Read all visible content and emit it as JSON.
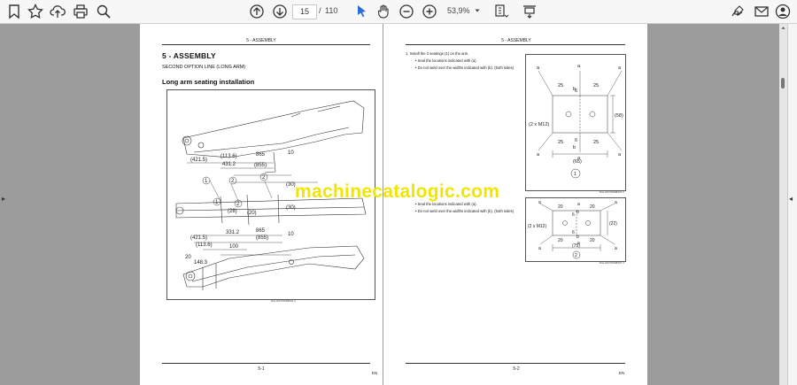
{
  "toolbar": {
    "current_page": "15",
    "page_separator": "/",
    "total_pages": "110",
    "zoom": "53,9%"
  },
  "left_page": {
    "header": "5 - ASSEMBLY",
    "title": "5 - ASSEMBLY",
    "subtitle": "SECOND OPTION LINE (LONG ARM)",
    "section": "Long arm seating installation",
    "figure_ref": "DALGSTOSSB001  1",
    "footer_page": "5-1",
    "dims": [
      "(421.5)",
      "(113.6)",
      "431.2",
      "865",
      "(855)",
      "10",
      "(421.5)",
      "(113.6)",
      "331.2",
      "865",
      "(855)",
      "10",
      "100",
      "20",
      "148.3",
      "(28)",
      "(20)",
      "(30)",
      "(30)",
      "1",
      "2",
      "2",
      "1",
      "2"
    ]
  },
  "right_page": {
    "header": "5 - ASSEMBLY",
    "instruction": "Install the 2 seatings (1) on the arm.",
    "bullet1": "Seal the locations indicated with (a).",
    "bullet2": "Do not weld over the widths indicated with (b). (both sides)",
    "bullet3": "Seal the locations indicated with (a).",
    "bullet4": "Do not weld over the widths indicated with (b). (both sides)",
    "figure_ref_1": "DALGSTOSSB007  2",
    "figure_ref_2": "DALGSTOSSB007  3",
    "footer_page": "5-2",
    "en": "EN",
    "fig1_labels": [
      "a",
      "a",
      "a",
      "a",
      "a",
      "a",
      "25",
      "25",
      "25",
      "25",
      "6",
      "6",
      "(2 x M12)",
      "(58)",
      "(65)",
      "b",
      "b",
      "1"
    ],
    "fig2_labels": [
      "a",
      "a",
      "a",
      "a",
      "a",
      "a",
      "20",
      "20",
      "20",
      "20",
      "6",
      "6",
      "(2 x M12)",
      "(22)",
      "(75)",
      "b",
      "b",
      "2"
    ]
  },
  "left_footer_en": "EN",
  "watermark": "machinecatalogic.com"
}
